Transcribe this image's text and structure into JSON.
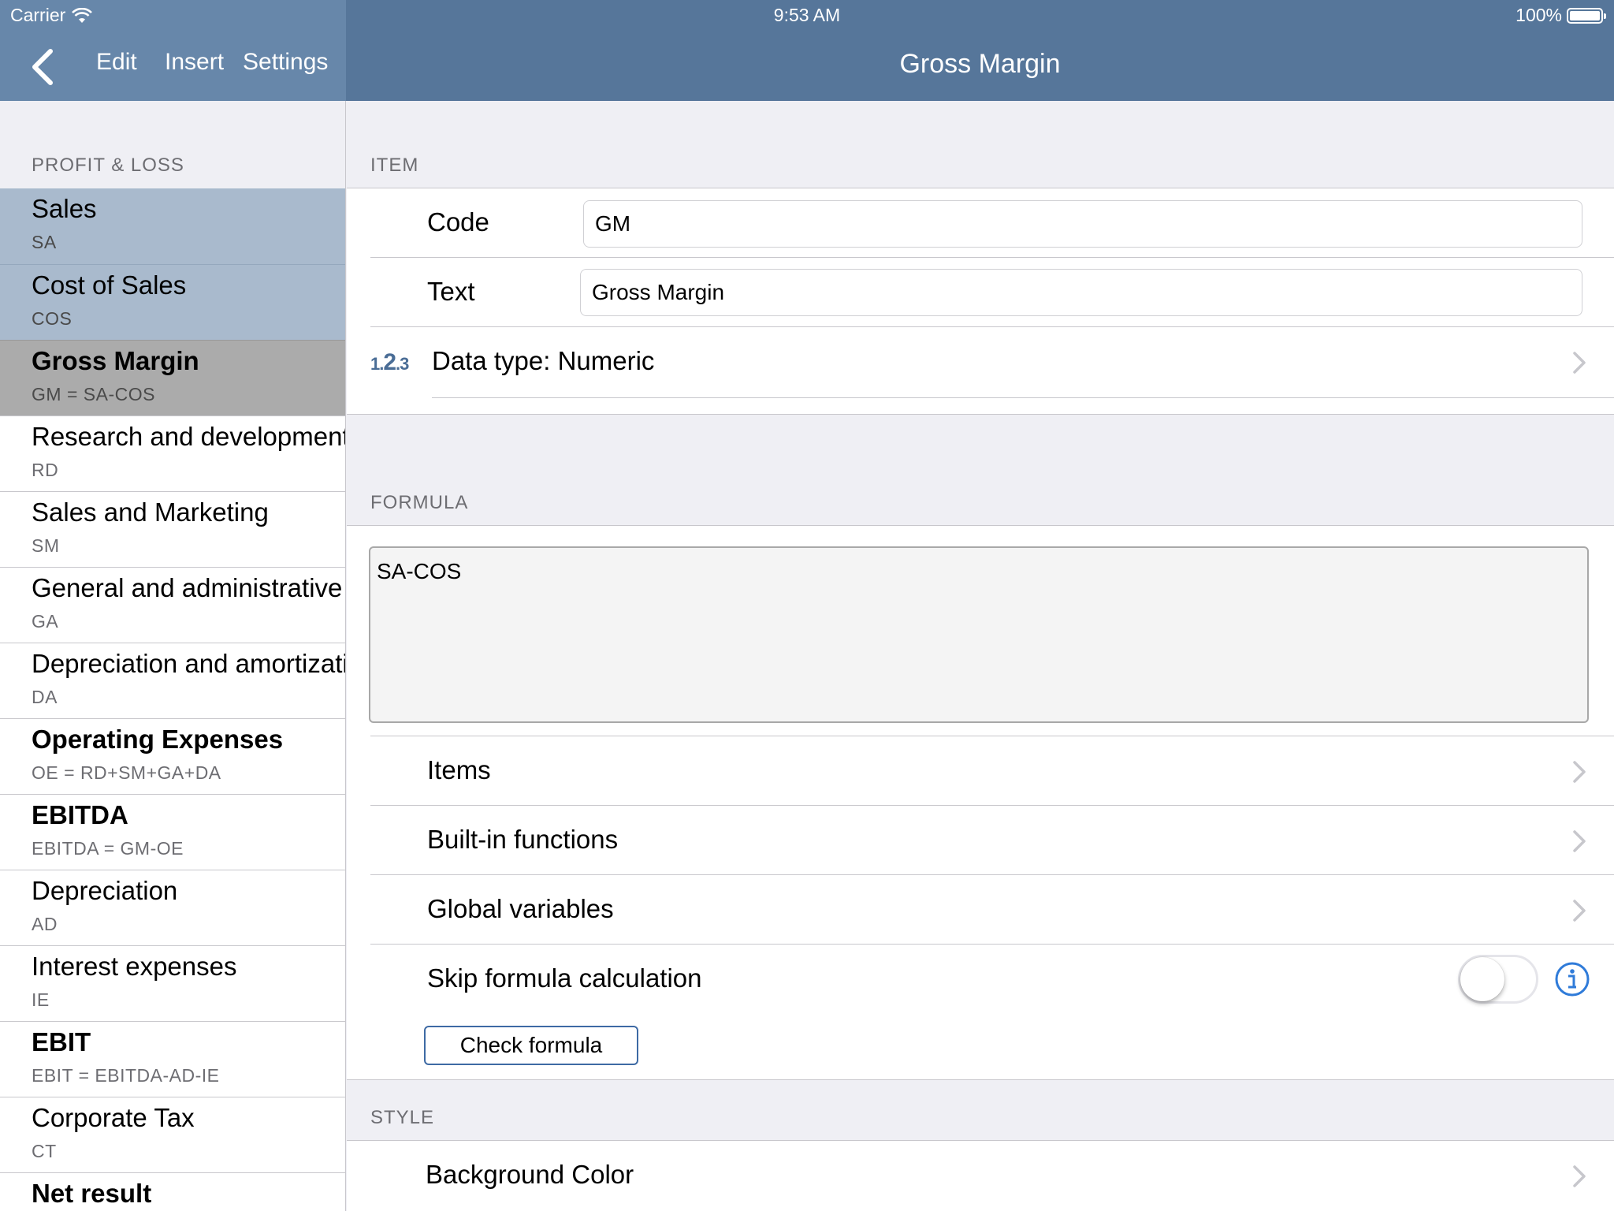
{
  "status_bar": {
    "carrier": "Carrier",
    "time": "9:53 AM",
    "battery": "100%"
  },
  "nav": {
    "edit_label": "Edit",
    "insert_label": "Insert",
    "settings_label": "Settings",
    "title": "Gross Margin"
  },
  "sidebar": {
    "section_title": "PROFIT & LOSS",
    "items": [
      {
        "title": "Sales",
        "sub": "SA"
      },
      {
        "title": "Cost of Sales",
        "sub": "COS"
      },
      {
        "title": "Gross Margin",
        "sub": "GM = SA-COS"
      },
      {
        "title": "Research and development",
        "sub": "RD"
      },
      {
        "title": "Sales and Marketing",
        "sub": "SM"
      },
      {
        "title": "General and administrative",
        "sub": "GA"
      },
      {
        "title": "Depreciation and amortization",
        "sub": "DA"
      },
      {
        "title": "Operating Expenses",
        "sub": "OE = RD+SM+GA+DA"
      },
      {
        "title": "EBITDA",
        "sub": "EBITDA = GM-OE"
      },
      {
        "title": "Depreciation",
        "sub": "AD"
      },
      {
        "title": "Interest expenses",
        "sub": "IE"
      },
      {
        "title": "EBIT",
        "sub": "EBIT = EBITDA-AD-IE"
      },
      {
        "title": "Corporate Tax",
        "sub": "CT"
      },
      {
        "title": "Net result",
        "sub": ""
      }
    ]
  },
  "item_section": {
    "header": "ITEM",
    "code_label": "Code",
    "code_value": "GM",
    "text_label": "Text",
    "text_value": "Gross Margin",
    "dtype_icon_a": "1.",
    "dtype_icon_b": "2",
    "dtype_icon_c": ".3",
    "dtype_label": "Data type: Numeric"
  },
  "formula_section": {
    "header": "FORMULA",
    "formula_value": "SA-COS",
    "items_label": "Items",
    "builtin_label": "Built-in functions",
    "globals_label": "Global variables",
    "skip_label": "Skip formula calculation",
    "skip_enabled": false,
    "check_label": "Check formula"
  },
  "style_section": {
    "header": "STYLE",
    "bg_label": "Background Color"
  },
  "colors": {
    "nav_bar": "#56769a",
    "nav_bar_left": "#6787aa",
    "selected_light": "#a9bacd",
    "selected_dark": "#ababab",
    "accent": "#2f7bd9"
  }
}
